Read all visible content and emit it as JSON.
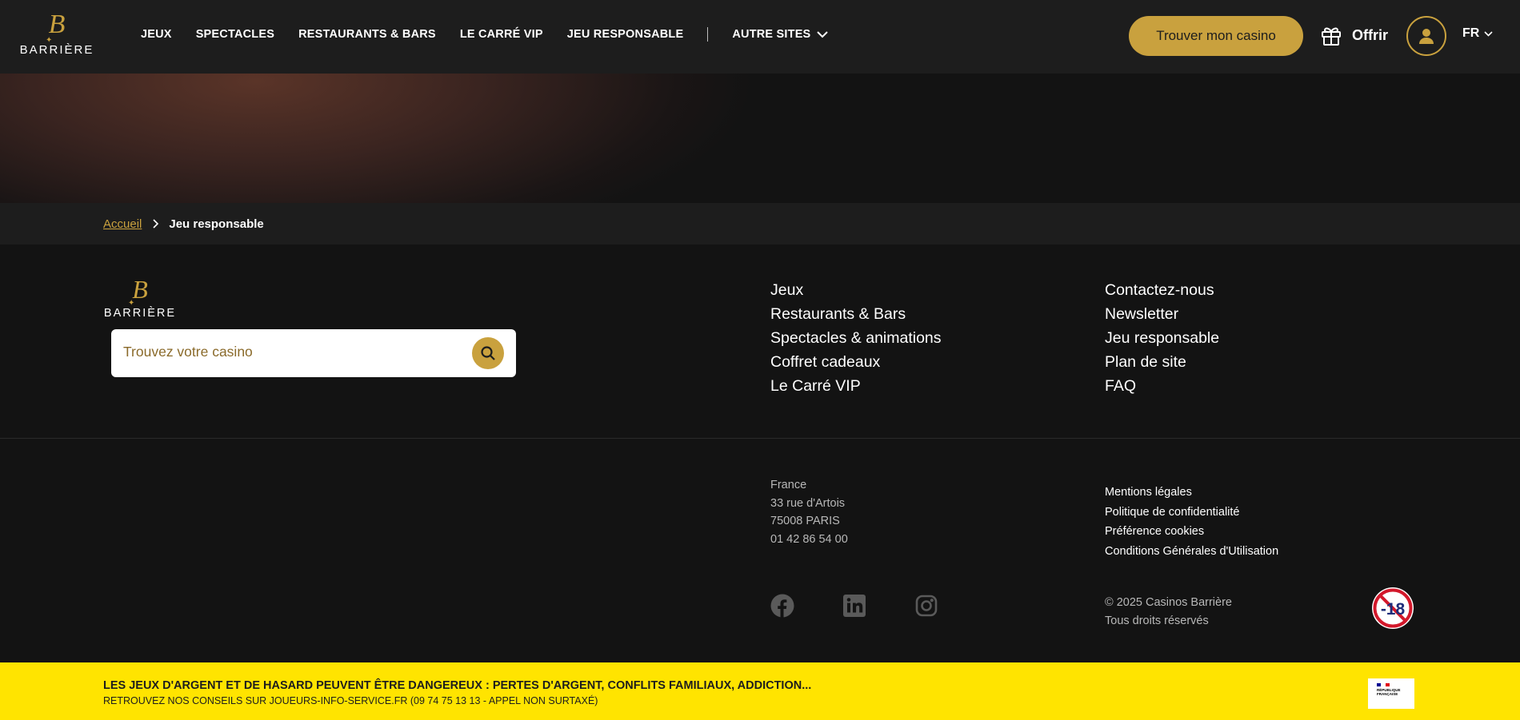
{
  "brand": {
    "name": "BARRIÈRE",
    "monogram": "B",
    "spark": "✦",
    "gold": "#c9a13e"
  },
  "header": {
    "nav": [
      {
        "label": "JEUX"
      },
      {
        "label": "SPECTACLES"
      },
      {
        "label": "RESTAURANTS & BARS"
      },
      {
        "label": "LE CARRÉ VIP"
      },
      {
        "label": "JEU RESPONSABLE"
      }
    ],
    "other_sites": "AUTRE SITES",
    "find_casino_button": "Trouver mon casino",
    "gift_label": "Offrir",
    "language": "FR",
    "icons": {
      "gift": "gift-icon",
      "account": "user-icon",
      "language": "chevron-down-icon"
    }
  },
  "breadcrumb": {
    "home": "Accueil",
    "current": "Jeu responsable"
  },
  "footer": {
    "search_placeholder": "Trouvez votre casino",
    "links_col1": [
      "Jeux",
      "Restaurants & Bars",
      "Spectacles & animations",
      "Coffret cadeaux",
      "Le Carré VIP"
    ],
    "links_col2": [
      "Contactez-nous",
      "Newsletter",
      "Jeu responsable",
      "Plan de site",
      "FAQ"
    ],
    "address": [
      "France",
      "33 rue d'Artois",
      "75008 PARIS",
      "01 42 86 54 00"
    ],
    "legal": [
      "Mentions légales",
      "Politique de confidentialité",
      "Préférence cookies",
      "Conditions Générales d'Utilisation"
    ],
    "social": [
      "facebook-icon",
      "linkedin-icon",
      "instagram-icon"
    ],
    "copyright": "© 2025 Casinos Barrière",
    "rights": "Tous droits réservés",
    "age_badge": "-18"
  },
  "warning": {
    "line1": "LES JEUX D'ARGENT ET DE HASARD PEUVENT ÊTRE DANGEREUX : PERTES D'ARGENT, CONFLITS FAMILIAUX, ADDICTION...",
    "line2": "RETROUVEZ NOS CONSEILS SUR JOUEURS-INFO-SERVICE.FR (09 74 75 13 13 - APPEL NON SURTAXÉ)",
    "background": "#ffe400",
    "gov_logo": [
      "RÉPUBLIQUE",
      "FRANÇAISE"
    ]
  }
}
